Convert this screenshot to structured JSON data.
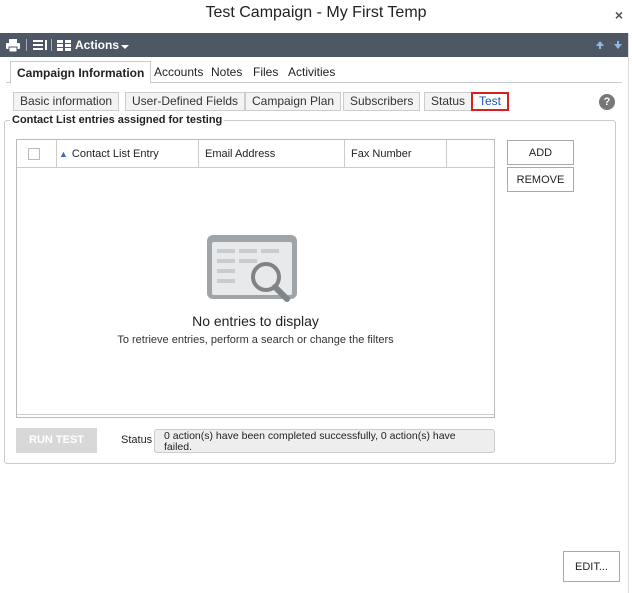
{
  "window": {
    "title": "Test Campaign - My First Temp",
    "close_glyph": "×"
  },
  "toolbar": {
    "actions_label": "Actions"
  },
  "tabs": [
    {
      "label": "Campaign Information",
      "active": true
    },
    {
      "label": "Accounts"
    },
    {
      "label": "Notes"
    },
    {
      "label": "Files"
    },
    {
      "label": "Activities"
    }
  ],
  "subtabs": [
    {
      "label": "Basic information"
    },
    {
      "label": "User-Defined Fields"
    },
    {
      "label": "Campaign Plan"
    },
    {
      "label": "Subscribers"
    },
    {
      "label": "Status"
    },
    {
      "label": "Test",
      "active": true
    }
  ],
  "help_glyph": "?",
  "section": {
    "legend": "Contact List entries assigned for testing",
    "columns": [
      "Contact List Entry",
      "Email Address",
      "Fax Number"
    ],
    "empty_title": "No entries to display",
    "empty_subtitle": "To retrieve entries, perform a search or change the filters"
  },
  "buttons": {
    "add": "ADD",
    "remove": "REMOVE",
    "run_test": "RUN TEST",
    "edit": "EDIT..."
  },
  "status": {
    "label": "Status",
    "text": "0 action(s) have been completed successfully, 0 action(s) have failed."
  },
  "colors": {
    "toolbar": "#4d5864",
    "accent": "#1a56b0",
    "highlight_border": "#d92020"
  }
}
